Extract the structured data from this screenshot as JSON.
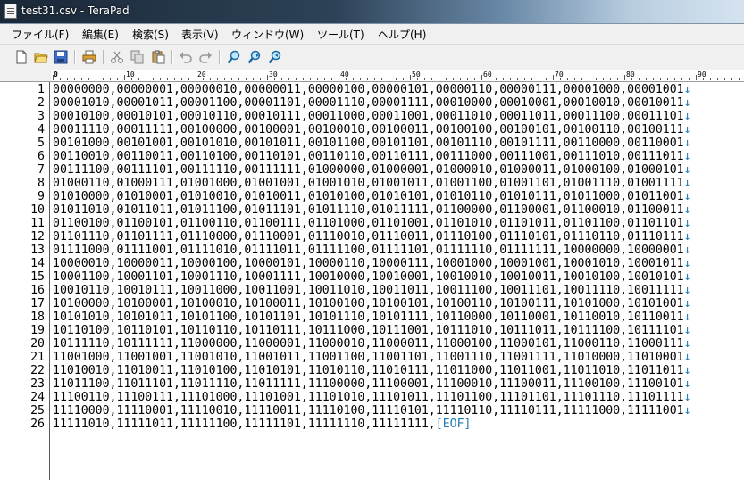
{
  "window": {
    "title": "test31.csv - TeraPad"
  },
  "menu": [
    "ファイル(F)",
    "編集(E)",
    "検索(S)",
    "表示(V)",
    "ウィンドウ(W)",
    "ツール(T)",
    "ヘルプ(H)"
  ],
  "ruler": [
    "0",
    "10",
    "20",
    "30",
    "40",
    "50",
    "60",
    "70",
    "80",
    "90"
  ],
  "newline_marker": "↓",
  "eof_marker": "[EOF]",
  "lines": [
    {
      "n": "1",
      "text": "00000000,00000001,00000010,00000011,00000100,00000101,00000110,00000111,00001000,00001001"
    },
    {
      "n": "2",
      "text": "00001010,00001011,00001100,00001101,00001110,00001111,00010000,00010001,00010010,00010011"
    },
    {
      "n": "3",
      "text": "00010100,00010101,00010110,00010111,00011000,00011001,00011010,00011011,00011100,00011101"
    },
    {
      "n": "4",
      "text": "00011110,00011111,00100000,00100001,00100010,00100011,00100100,00100101,00100110,00100111"
    },
    {
      "n": "5",
      "text": "00101000,00101001,00101010,00101011,00101100,00101101,00101110,00101111,00110000,00110001"
    },
    {
      "n": "6",
      "text": "00110010,00110011,00110100,00110101,00110110,00110111,00111000,00111001,00111010,00111011"
    },
    {
      "n": "7",
      "text": "00111100,00111101,00111110,00111111,01000000,01000001,01000010,01000011,01000100,01000101"
    },
    {
      "n": "8",
      "text": "01000110,01000111,01001000,01001001,01001010,01001011,01001100,01001101,01001110,01001111"
    },
    {
      "n": "9",
      "text": "01010000,01010001,01010010,01010011,01010100,01010101,01010110,01010111,01011000,01011001"
    },
    {
      "n": "10",
      "text": "01011010,01011011,01011100,01011101,01011110,01011111,01100000,01100001,01100010,01100011"
    },
    {
      "n": "11",
      "text": "01100100,01100101,01100110,01100111,01101000,01101001,01101010,01101011,01101100,01101101"
    },
    {
      "n": "12",
      "text": "01101110,01101111,01110000,01110001,01110010,01110011,01110100,01110101,01110110,01110111"
    },
    {
      "n": "13",
      "text": "01111000,01111001,01111010,01111011,01111100,01111101,01111110,01111111,10000000,10000001"
    },
    {
      "n": "14",
      "text": "10000010,10000011,10000100,10000101,10000110,10000111,10001000,10001001,10001010,10001011"
    },
    {
      "n": "15",
      "text": "10001100,10001101,10001110,10001111,10010000,10010001,10010010,10010011,10010100,10010101"
    },
    {
      "n": "16",
      "text": "10010110,10010111,10011000,10011001,10011010,10011011,10011100,10011101,10011110,10011111"
    },
    {
      "n": "17",
      "text": "10100000,10100001,10100010,10100011,10100100,10100101,10100110,10100111,10101000,10101001"
    },
    {
      "n": "18",
      "text": "10101010,10101011,10101100,10101101,10101110,10101111,10110000,10110001,10110010,10110011"
    },
    {
      "n": "19",
      "text": "10110100,10110101,10110110,10110111,10111000,10111001,10111010,10111011,10111100,10111101"
    },
    {
      "n": "20",
      "text": "10111110,10111111,11000000,11000001,11000010,11000011,11000100,11000101,11000110,11000111"
    },
    {
      "n": "21",
      "text": "11001000,11001001,11001010,11001011,11001100,11001101,11001110,11001111,11010000,11010001"
    },
    {
      "n": "22",
      "text": "11010010,11010011,11010100,11010101,11010110,11010111,11011000,11011001,11011010,11011011"
    },
    {
      "n": "23",
      "text": "11011100,11011101,11011110,11011111,11100000,11100001,11100010,11100011,11100100,11100101"
    },
    {
      "n": "24",
      "text": "11100110,11100111,11101000,11101001,11101010,11101011,11101100,11101101,11101110,11101111"
    },
    {
      "n": "25",
      "text": "11110000,11110001,11110010,11110011,11110100,11110101,11110110,11110111,11111000,11111001"
    },
    {
      "n": "26",
      "text": "11111010,11111011,11111100,11111101,11111110,11111111,"
    }
  ]
}
